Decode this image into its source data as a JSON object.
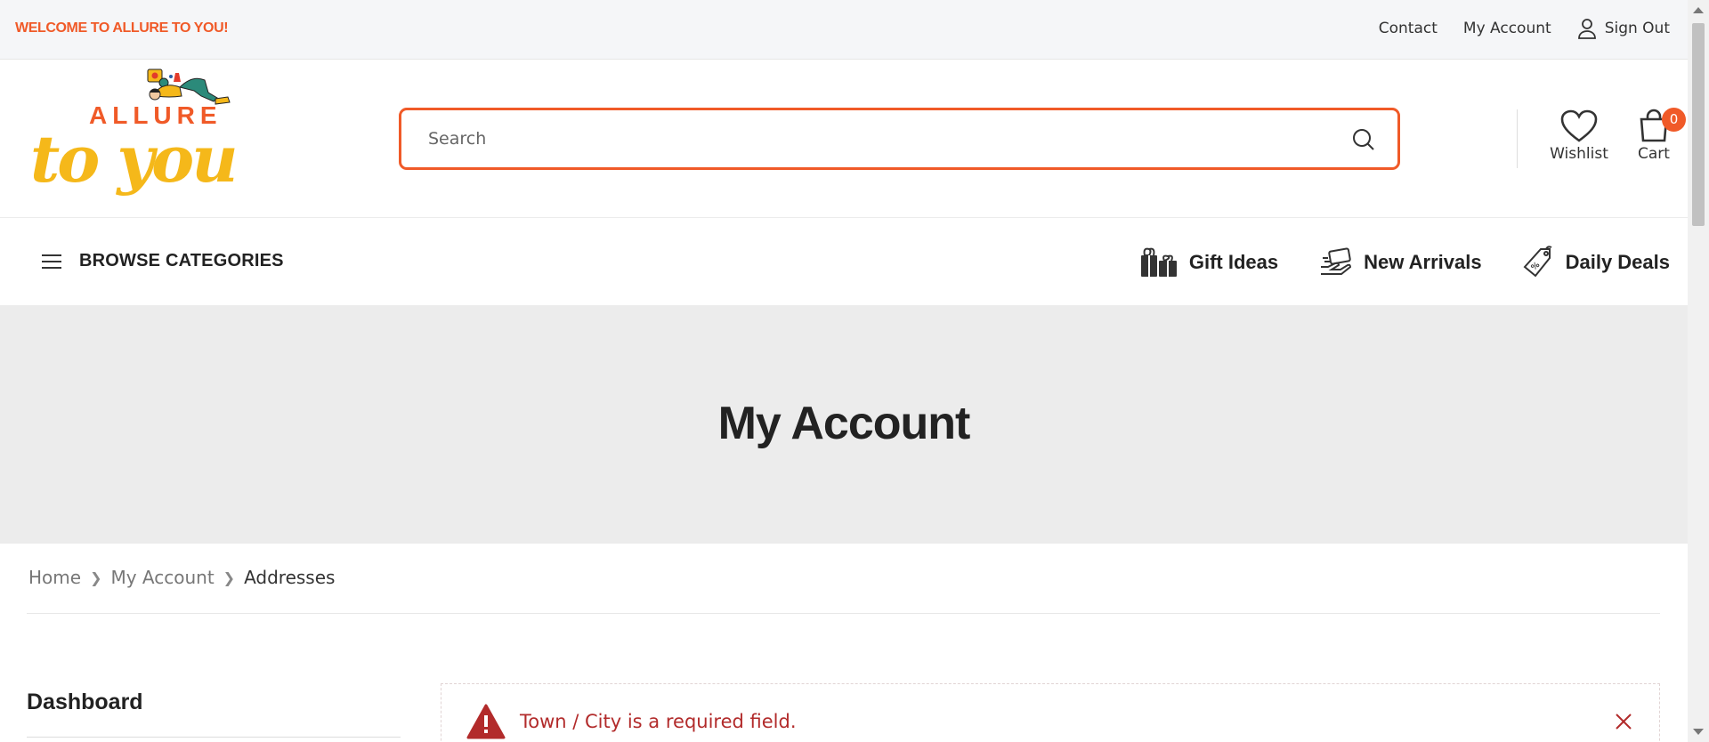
{
  "topbar": {
    "welcome": "WELCOME TO ALLURE TO YOU!",
    "links": {
      "contact": "Contact",
      "my_account": "My Account",
      "sign_out": "Sign Out"
    }
  },
  "logo": {
    "word_top": "ALLURE",
    "word_bottom": "to you"
  },
  "search": {
    "placeholder": "Search",
    "value": ""
  },
  "header_icons": {
    "wishlist": "Wishlist",
    "cart": "Cart",
    "cart_count": "0"
  },
  "nav": {
    "browse": "BROWSE CATEGORIES",
    "links": [
      "Gift Ideas",
      "New Arrivals",
      "Daily Deals"
    ]
  },
  "hero": {
    "title": "My Account"
  },
  "breadcrumb": [
    "Home",
    "My Account",
    "Addresses"
  ],
  "sidebar": {
    "heading": "Dashboard"
  },
  "notice": {
    "message": "Town / City is a required field."
  },
  "colors": {
    "brand_orange": "#f05a28",
    "brand_yellow": "#f5b81a",
    "error_red": "#b22b2b",
    "hero_bg": "#ececec"
  }
}
